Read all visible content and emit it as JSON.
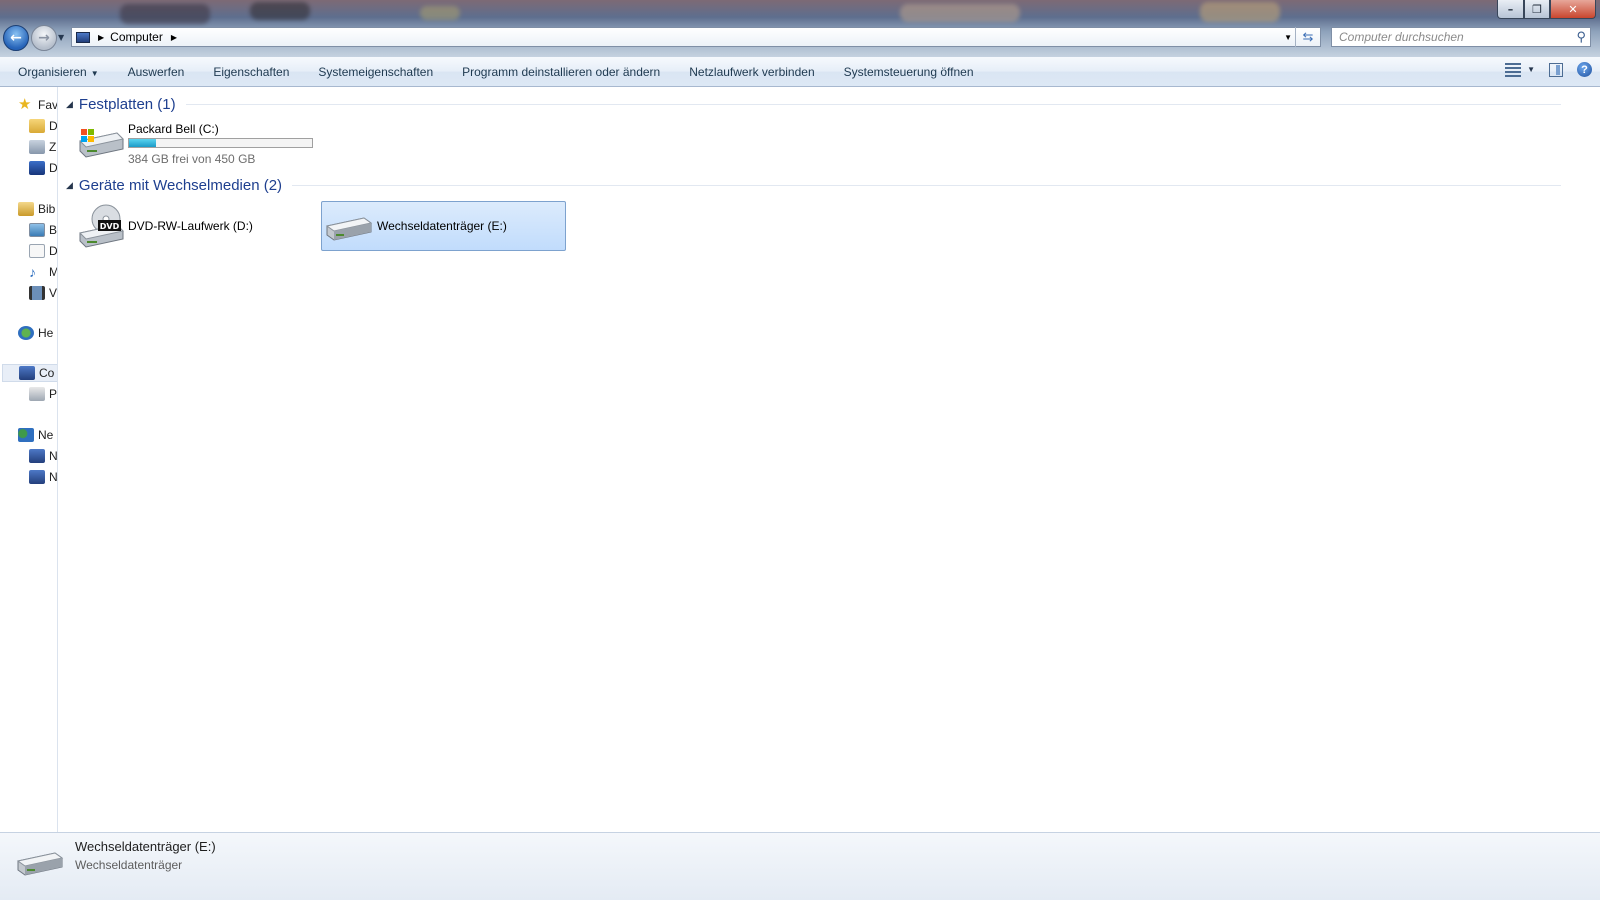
{
  "window": {
    "controls": [
      "minimize",
      "maximize",
      "close"
    ]
  },
  "address": {
    "breadcrumb": "Computer",
    "search_placeholder": "Computer durchsuchen"
  },
  "toolbar": {
    "commands": [
      "Organisieren",
      "Auswerfen",
      "Eigenschaften",
      "Systemeigenschaften",
      "Programm deinstallieren oder ändern",
      "Netzlaufwerk verbinden",
      "Systemsteuerung öffnen"
    ]
  },
  "nav": {
    "items": [
      {
        "label": "Fav",
        "icon": "star-icon"
      },
      {
        "label": "D",
        "icon": "folder-icon"
      },
      {
        "label": "Z",
        "icon": "recent-icon"
      },
      {
        "label": "D",
        "icon": "desktop-icon"
      },
      {
        "label": "Bib",
        "icon": "library-icon"
      },
      {
        "label": "B",
        "icon": "pictures-icon"
      },
      {
        "label": "D",
        "icon": "documents-icon"
      },
      {
        "label": "M",
        "icon": "music-icon"
      },
      {
        "label": "V",
        "icon": "videos-icon"
      },
      {
        "label": "He",
        "icon": "homegroup-icon"
      },
      {
        "label": "Co",
        "icon": "computer-icon"
      },
      {
        "label": "P",
        "icon": "drive-icon"
      },
      {
        "label": "Ne",
        "icon": "network-icon"
      },
      {
        "label": "N",
        "icon": "network-computer-icon"
      },
      {
        "label": "N",
        "icon": "network-computer-icon"
      }
    ]
  },
  "groups": [
    {
      "title": "Festplatten (1)",
      "items": [
        {
          "name": "Packard Bell (C:)",
          "free_text": "384 GB frei von 450 GB",
          "used_fraction": 0.147
        }
      ]
    },
    {
      "title": "Geräte mit Wechselmedien (2)",
      "items": [
        {
          "name": "DVD-RW-Laufwerk (D:)",
          "icon_label": "DVD"
        },
        {
          "name": "Wechseldatenträger (E:)",
          "selected": true
        }
      ]
    }
  ],
  "details": {
    "name": "Wechseldatenträger (E:)",
    "type": "Wechseldatenträger"
  },
  "colors": {
    "accent_header": "#1e3f8f",
    "selection": "#c1dcfc",
    "usage_bar": "#1b9ac7"
  }
}
